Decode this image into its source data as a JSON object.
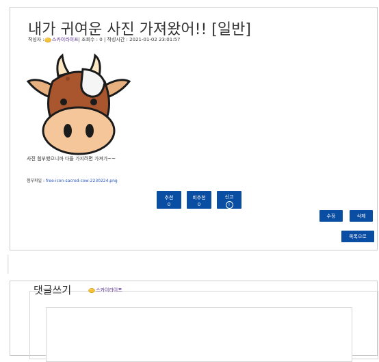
{
  "post": {
    "title": "내가 귀여운 사진 가져왔어!! [일반]",
    "meta_author_label": "작성자 :",
    "author": "스카이라이프",
    "meta_views": "| 조회수 : 0 | 작성시간 : 2021-01-02 23:01:57",
    "body": "사진 힘부했으니까 다들 가지려면 가져가~~",
    "attachment_label": "첨부파일 :",
    "attachment_name": "free-icon-sacred-cow-2230224.png"
  },
  "votes": {
    "recommend_label": "추천",
    "recommend_count": "0",
    "notrecommend_label": "비추천",
    "notrecommend_count": "0",
    "report_label": "신고",
    "report_icon": "!"
  },
  "actions": {
    "edit_label": "수정",
    "delete_label": "삭제",
    "list_label": "목록으로"
  },
  "comment": {
    "heading": "댓글쓰기",
    "user": "스카이라이프"
  },
  "icons": {
    "user_icon": "user-hand-icon",
    "image": "cow-icon",
    "report": "info-circle-icon"
  },
  "colors": {
    "button_blue": "#0a4ea3",
    "author_purple": "#5a2d9b",
    "link_blue": "#1f4fbf"
  }
}
